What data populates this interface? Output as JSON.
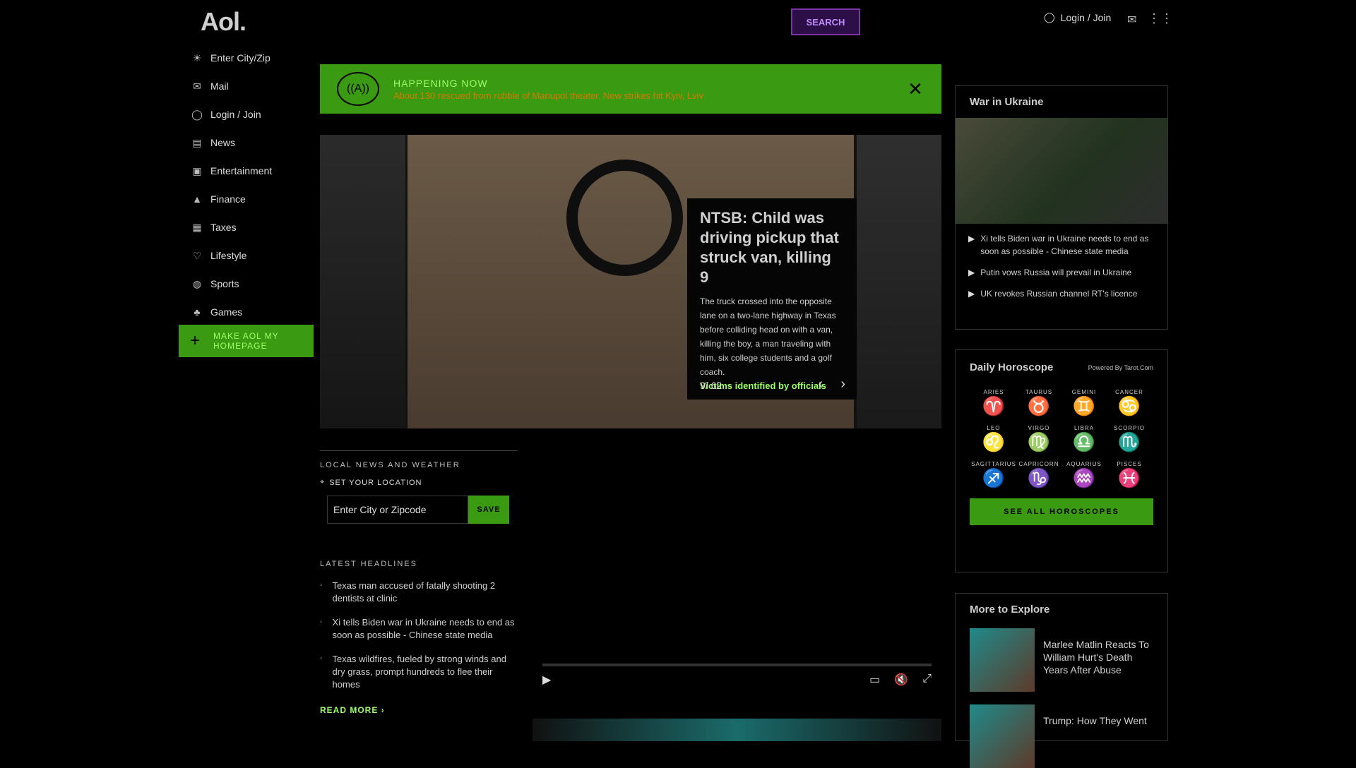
{
  "header": {
    "logo": "Aol.",
    "search_button": "SEARCH",
    "login": "Login / Join"
  },
  "nav": {
    "items": [
      {
        "icon": "weather-icon",
        "label": "Enter City/Zip"
      },
      {
        "icon": "mail-icon",
        "label": "Mail"
      },
      {
        "icon": "user-icon",
        "label": "Login / Join"
      },
      {
        "icon": "news-icon",
        "label": "News"
      },
      {
        "icon": "clapper-icon",
        "label": "Entertainment"
      },
      {
        "icon": "chart-icon",
        "label": "Finance"
      },
      {
        "icon": "taxes-icon",
        "label": "Taxes"
      },
      {
        "icon": "heart-icon",
        "label": "Lifestyle"
      },
      {
        "icon": "ball-icon",
        "label": "Sports"
      },
      {
        "icon": "games-icon",
        "label": "Games"
      }
    ],
    "make_homepage": "MAKE AOL MY HOMEPAGE"
  },
  "banner": {
    "title": "HAPPENING NOW",
    "message": "About 130 rescued from rubble of Mariupol theater. New strikes hit Kyiv, Lviv"
  },
  "carousel": {
    "headline": "NTSB: Child was driving pickup that struck van, killing 9",
    "body": "The truck crossed into the opposite lane on a two-lane highway in Texas before colliding head on with a van, killing the boy, a man traveling with him, six college students and a golf coach.",
    "link": "Victims identified by officials",
    "counter": "9/ 62"
  },
  "local": {
    "heading": "LOCAL NEWS AND WEATHER",
    "set_location": "SET YOUR LOCATION",
    "input_placeholder": "Enter City or Zipcode",
    "save": "SAVE"
  },
  "headlines": {
    "heading": "LATEST HEADLINES",
    "items": [
      "Texas man accused of fatally shooting 2 dentists at clinic",
      "Xi tells Biden war in Ukraine needs to end as soon as possible - Chinese state media",
      "Texas wildfires, fueled by strong winds and dry grass, prompt hundreds to flee their homes"
    ],
    "read_more": "READ MORE ›"
  },
  "ukraine": {
    "title": "War in Ukraine",
    "items": [
      "Xi tells Biden war in Ukraine needs to end as soon as possible - Chinese state media",
      "Putin vows Russia will prevail in Ukraine",
      "UK revokes Russian channel RT's licence"
    ]
  },
  "horoscope": {
    "title": "Daily Horoscope",
    "powered_by": "Powered By Tarot.Com",
    "signs": [
      {
        "name": "ARIES",
        "glyph": "♈"
      },
      {
        "name": "TAURUS",
        "glyph": "♉"
      },
      {
        "name": "GEMINI",
        "glyph": "♊"
      },
      {
        "name": "CANCER",
        "glyph": "♋"
      },
      {
        "name": "LEO",
        "glyph": "♌"
      },
      {
        "name": "VIRGO",
        "glyph": "♍"
      },
      {
        "name": "LIBRA",
        "glyph": "♎"
      },
      {
        "name": "SCORPIO",
        "glyph": "♏"
      },
      {
        "name": "SAGITTARIUS",
        "glyph": "♐"
      },
      {
        "name": "CAPRICORN",
        "glyph": "♑"
      },
      {
        "name": "AQUARIUS",
        "glyph": "♒"
      },
      {
        "name": "PISCES",
        "glyph": "♓"
      }
    ],
    "see_all": "SEE ALL HOROSCOPES"
  },
  "explore": {
    "title": "More to Explore",
    "items": [
      "Marlee Matlin Reacts To William Hurt's Death Years After Abuse",
      "Trump: How They Went"
    ]
  }
}
